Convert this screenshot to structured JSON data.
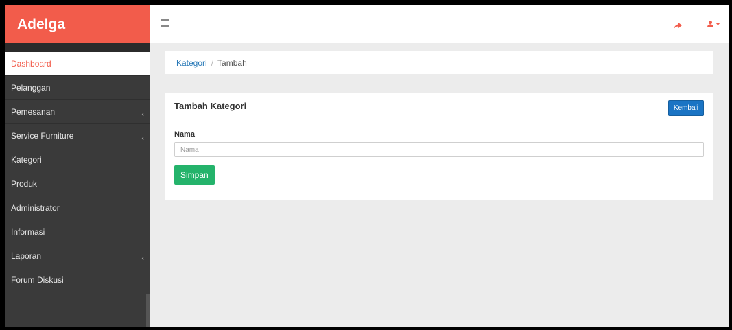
{
  "brand": {
    "name": "Adelga"
  },
  "colors": {
    "accent": "#f25c4b",
    "sidebar": "#3a3a3a",
    "primary": "#1a74c4",
    "success": "#24b36b"
  },
  "header": {
    "menu_icon": "hamburger-icon",
    "share_icon": "share-icon",
    "user_icon": "user-icon"
  },
  "sidebar": {
    "items": [
      {
        "label": "Dashboard",
        "active": true,
        "has_children": false
      },
      {
        "label": "Pelanggan",
        "active": false,
        "has_children": false
      },
      {
        "label": "Pemesanan",
        "active": false,
        "has_children": true
      },
      {
        "label": "Service Furniture",
        "active": false,
        "has_children": true
      },
      {
        "label": "Kategori",
        "active": false,
        "has_children": false
      },
      {
        "label": "Produk",
        "active": false,
        "has_children": false
      },
      {
        "label": "Administrator",
        "active": false,
        "has_children": false
      },
      {
        "label": "Informasi",
        "active": false,
        "has_children": false
      },
      {
        "label": "Laporan",
        "active": false,
        "has_children": true
      },
      {
        "label": "Forum Diskusi",
        "active": false,
        "has_children": false
      }
    ]
  },
  "breadcrumb": {
    "parent": "Kategori",
    "separator": "/",
    "current": "Tambah"
  },
  "form": {
    "title": "Tambah Kategori",
    "back_label": "Kembali",
    "field_label": "Nama",
    "field_placeholder": "Nama",
    "field_value": "",
    "save_label": "Simpan"
  }
}
